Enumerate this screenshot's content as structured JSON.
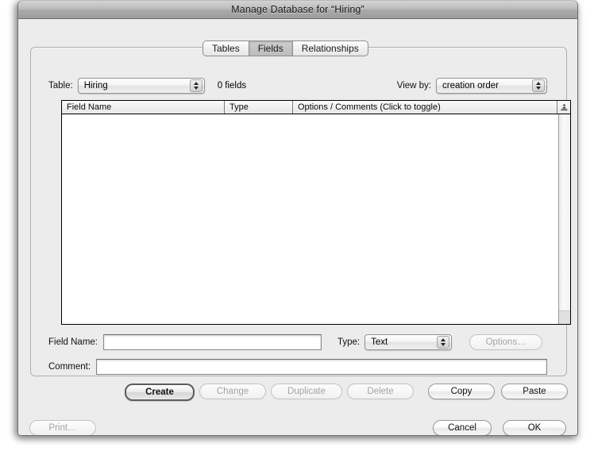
{
  "window": {
    "title": "Manage Database for “Hiring”"
  },
  "tabs": [
    {
      "label": "Tables",
      "selected": false
    },
    {
      "label": "Fields",
      "selected": true
    },
    {
      "label": "Relationships",
      "selected": false
    }
  ],
  "toolbar": {
    "table_label": "Table:",
    "table_value": "Hiring",
    "fields_count": "0 fields",
    "viewby_label": "View by:",
    "viewby_value": "creation order"
  },
  "list": {
    "columns": [
      {
        "label": "Field Name"
      },
      {
        "label": "Type"
      },
      {
        "label": "Options / Comments   (Click to toggle)"
      }
    ],
    "sort_icon": "sort-ascending-icon",
    "rows": []
  },
  "form": {
    "fieldname_label": "Field Name:",
    "fieldname_value": "",
    "fieldname_placeholder": "",
    "type_label": "Type:",
    "type_value": "Text",
    "options_button": "Options…",
    "comment_label": "Comment:",
    "comment_value": "",
    "comment_placeholder": ""
  },
  "actions": [
    {
      "label": "Create",
      "state": "default"
    },
    {
      "label": "Change",
      "state": "disabled"
    },
    {
      "label": "Duplicate",
      "state": "disabled"
    },
    {
      "label": "Delete",
      "state": "disabled"
    },
    {
      "label": "Copy",
      "state": "enabled"
    },
    {
      "label": "Paste",
      "state": "enabled"
    }
  ],
  "footer": {
    "print": "Print…",
    "cancel": "Cancel",
    "ok": "OK"
  },
  "colors": {
    "window_background": "#ececec",
    "titlebar_top": "#d3d3d3",
    "titlebar_bottom": "#9d9d9d",
    "list_background": "#ffffff",
    "selected_tab": "#c4c4c4"
  }
}
